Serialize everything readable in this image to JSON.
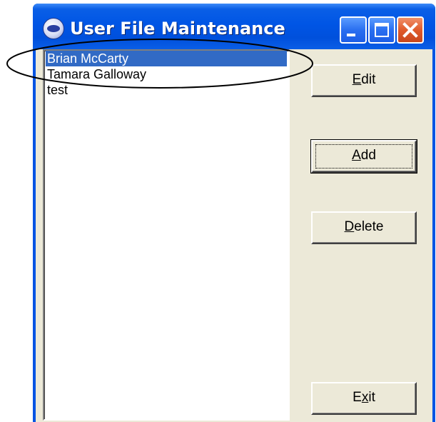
{
  "window": {
    "title": "User File Maintenance",
    "app_icon": "msco-logo-icon",
    "controls": {
      "minimize_icon": "minimize-icon",
      "maximize_icon": "maximize-icon",
      "close_icon": "close-icon"
    }
  },
  "user_list": {
    "items": [
      {
        "label": "Brian McCarty",
        "selected": true
      },
      {
        "label": "Tamara Galloway",
        "selected": false
      },
      {
        "label": "test",
        "selected": false
      }
    ]
  },
  "buttons": {
    "edit": {
      "mnemonic": "E",
      "rest": "dit"
    },
    "add": {
      "mnemonic": "A",
      "rest": "dd",
      "default": true
    },
    "delete": {
      "mnemonic": "D",
      "rest": "elete"
    },
    "exit": {
      "prefix": "E",
      "mnemonic": "x",
      "rest": "it"
    }
  },
  "annotation": {
    "shape": "ellipse",
    "target": "user_list.items.0",
    "color": "#000000"
  },
  "colors": {
    "titlebar": "#0055e5",
    "selection": "#316ac5",
    "face": "#ece9d8",
    "close_button": "#e05a2a"
  }
}
